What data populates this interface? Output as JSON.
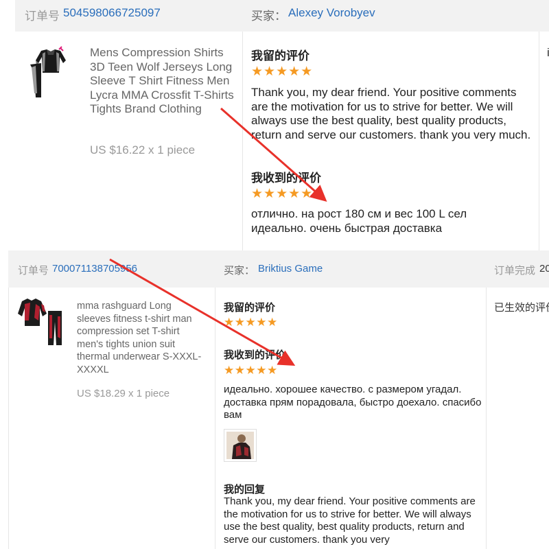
{
  "order1": {
    "order_label": "订单号",
    "order_number": "504598066725097",
    "buyer_label": "买家：",
    "buyer_name": "Alexey Vorobyev",
    "product_title": "Mens Compression Shirts 3D Teen Wolf Jerseys Long Sleeve T Shirt Fitness Men Lycra MMA Crossfit T-Shirts Tights Brand Clothing",
    "product_price": "US $16.22 x 1 piece",
    "my_review_heading": "我留的评价",
    "my_review_stars": "★★★★★",
    "my_review_text": "Thank you, my dear friend. Your positive comments are the motivation for us to strive for better. We will always use the best quality, best quality products, return and serve our customers. thank you very much.",
    "received_heading": "我收到的评价",
    "received_stars": "★★★★★",
    "received_text": "отлично. на рост 180 см и вес 100 L сел идеально. очень быстрая доставка"
  },
  "order2": {
    "order_label": "订单号",
    "order_number": "700071138705956",
    "buyer_label": "买家：",
    "buyer_name": "Briktius Game",
    "completed_label": "订单完成",
    "completed_value": "20",
    "product_title": "mma rashguard Long sleeves fitness t-shirt man compression set T-shirt men's tights union suit thermal underwear S-XXXL-XXXXL",
    "product_price": "US $18.29 x 1 piece",
    "my_review_heading": "我留的评价",
    "my_review_stars": "★★★★★",
    "received_heading": "我收到的评价",
    "received_stars": "★★★★★",
    "received_text": "идеально. хорошее качество. с размером угадал. доставка прям порадовала, быстро доехало. спасибо вам",
    "status_text": "已生效的评价",
    "reply_heading": "我的回复",
    "reply_text": "Thank you, my dear friend. Your positive comments are the motivation for us to strive for better. We will always use the best quality, best quality products, return and serve our customers. thank you very"
  },
  "colors": {
    "link": "#2a6ebb",
    "star": "#f59a23",
    "arrow": "#e8312a",
    "header_bg": "#f2f2f2"
  },
  "icons": {
    "arrow": "red-arrow-annotation"
  }
}
